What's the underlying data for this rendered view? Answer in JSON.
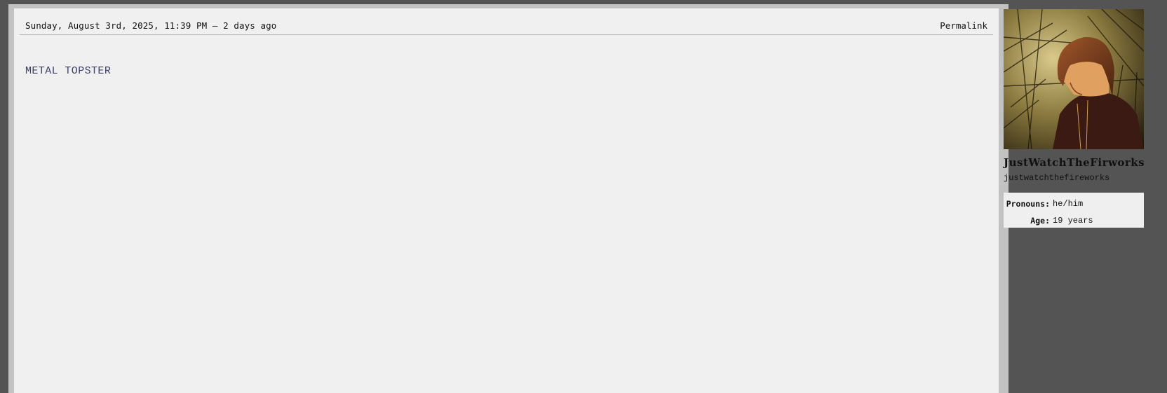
{
  "post": {
    "date": "Sunday, August 3rd, 2025, 11:39 PM — 2 days ago",
    "permalink_label": "Permalink",
    "body": "METAL TOPSTER"
  },
  "profile": {
    "avatar_icon": "profile-picture-anime-girl",
    "display_name": "JustWatchTheFirworks",
    "username": "justwatchthefireworks",
    "fields": [
      {
        "label": "Pronouns:",
        "value": "he/him"
      },
      {
        "label": "Age:",
        "value": "19 years"
      }
    ]
  },
  "colors": {
    "page_background": "#545454",
    "post_background": "#f0f0f0",
    "body_text": "#3d3f6b"
  }
}
